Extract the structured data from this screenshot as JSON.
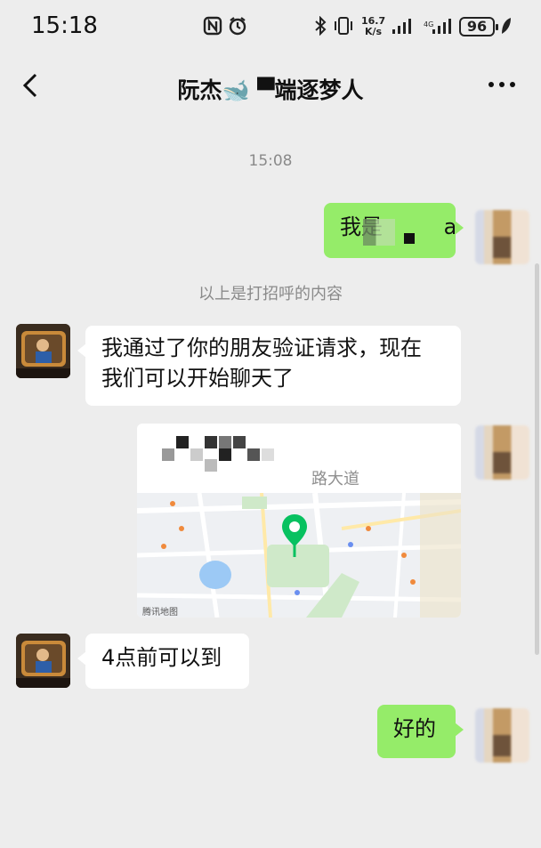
{
  "status_bar": {
    "time": "15:18",
    "net_speed_value": "16.7",
    "net_speed_unit": "K/s",
    "battery": "96",
    "icons": [
      "nfc-icon",
      "alarm-icon",
      "bluetooth-icon",
      "vibrate-icon",
      "signal-icon",
      "signal-icon",
      "leaf-icon"
    ]
  },
  "nav": {
    "title": "阮杰🐋 ▀端逐梦人",
    "back_icon": "chevron-left-icon",
    "more_icon": "more-dots-icon"
  },
  "chat": {
    "timestamp": "15:08",
    "greeting_message": "我是         a",
    "system_note": "以上是打招呼的内容",
    "peer_message_1_line1": "我通过了你的朋友验证请求，现在",
    "peer_message_1_line2": "我们可以开始聊天了",
    "location": {
      "address": "路大道",
      "map_provider": "腾讯地图",
      "pin_icon": "map-pin-icon"
    },
    "peer_message_2": "4点前可以到",
    "my_reply": "好的"
  },
  "colors": {
    "background": "#ededed",
    "outgoing_bubble": "#95ec69",
    "incoming_bubble": "#ffffff",
    "map_pin": "#07c160"
  }
}
